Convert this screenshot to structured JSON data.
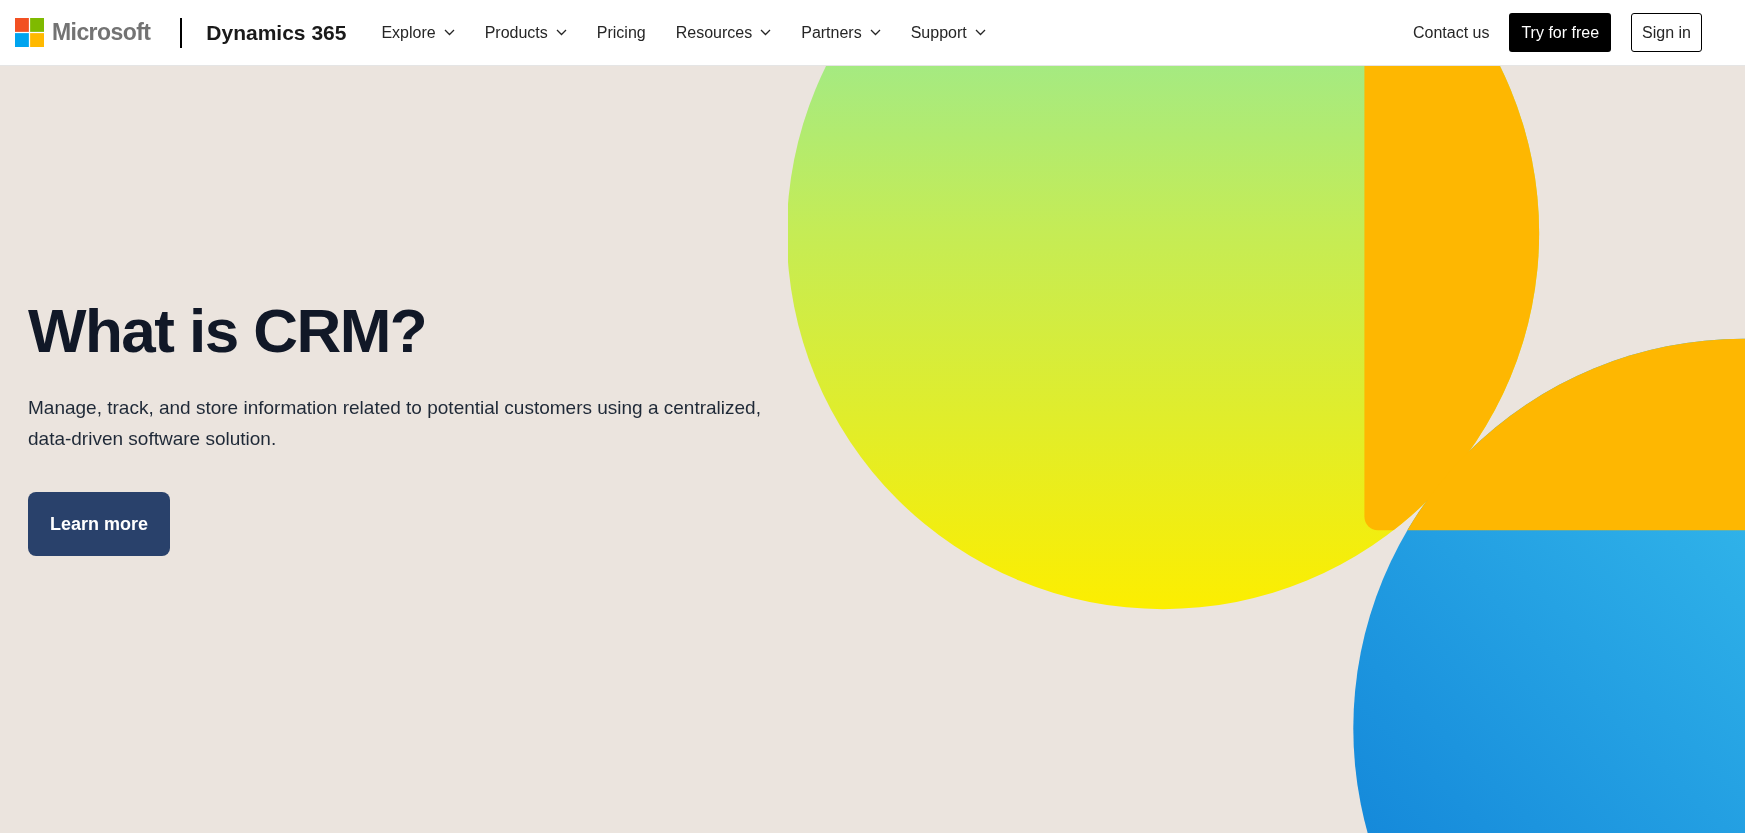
{
  "header": {
    "brand": "Microsoft",
    "product": "Dynamics 365",
    "nav": [
      {
        "label": "Explore",
        "has_dropdown": true
      },
      {
        "label": "Products",
        "has_dropdown": true
      },
      {
        "label": "Pricing",
        "has_dropdown": false
      },
      {
        "label": "Resources",
        "has_dropdown": true
      },
      {
        "label": "Partners",
        "has_dropdown": true
      },
      {
        "label": "Support",
        "has_dropdown": true
      }
    ],
    "actions": [
      {
        "kind": "link",
        "label": "Contact us"
      },
      {
        "kind": "primary",
        "label": "Try for free"
      },
      {
        "kind": "outline",
        "label": "Sign in"
      }
    ]
  },
  "hero": {
    "title": "What is CRM?",
    "description": "Manage, track, and store information related to potential customers using a centralized, data-driven software solution.",
    "button": "Learn more"
  }
}
